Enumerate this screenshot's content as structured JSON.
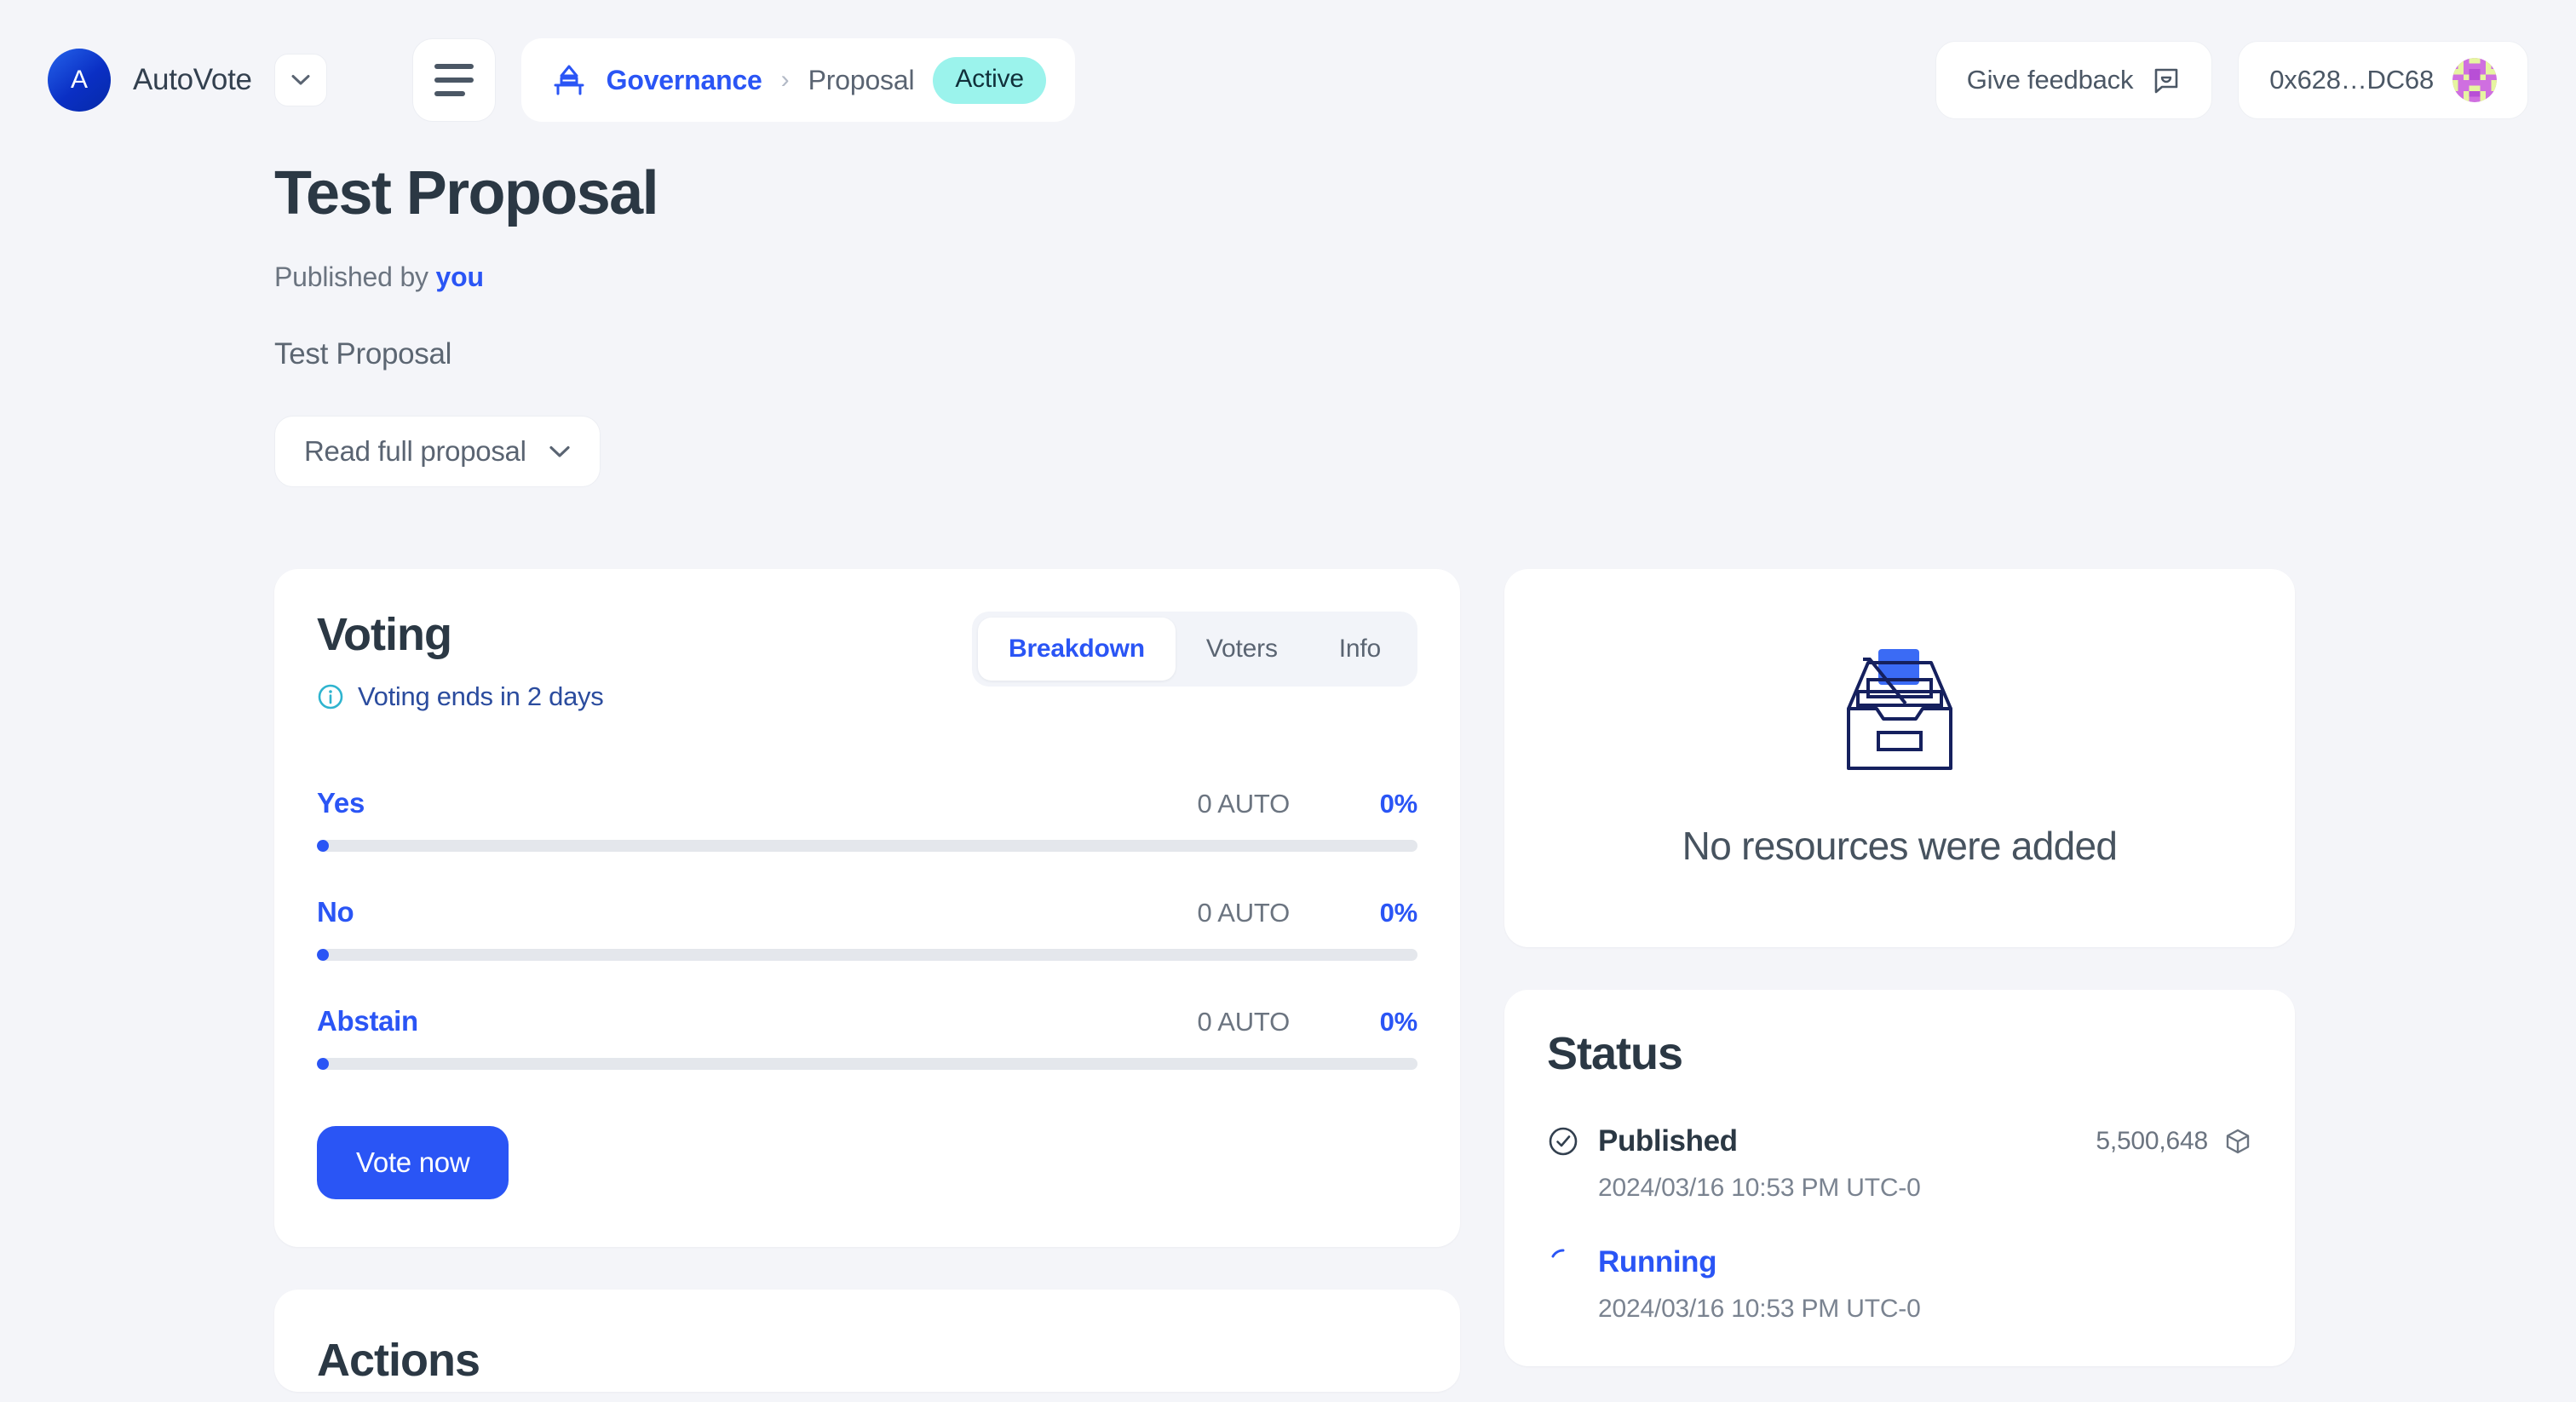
{
  "topbar": {
    "brand_initial": "A",
    "brand_name": "AutoVote",
    "brand_dropdown_icon": "chevron-down-icon",
    "menu_icon": "hamburger-menu-icon",
    "breadcrumb": {
      "icon": "governance-ballot-icon",
      "root": "Governance",
      "separator": "›",
      "current": "Proposal",
      "status": "Active",
      "status_color": "#9bf3ec"
    },
    "feedback_label": "Give feedback",
    "feedback_icon": "speech-bubble-smile-icon",
    "wallet_address": "0x628…DC68",
    "wallet_avatar_icon": "blockies-avatar"
  },
  "proposal": {
    "title": "Test Proposal",
    "published_prefix": "Published by",
    "published_author": "you",
    "summary": "Test Proposal",
    "read_full_label": "Read full proposal",
    "read_full_icon": "chevron-down-icon"
  },
  "voting": {
    "title": "Voting",
    "ends_icon": "info-circle-icon",
    "ends_text": "Voting ends in 2 days",
    "tabs": [
      {
        "label": "Breakdown",
        "active": true
      },
      {
        "label": "Voters",
        "active": false
      },
      {
        "label": "Info",
        "active": false
      }
    ],
    "options": [
      {
        "label": "Yes",
        "amount": "0 AUTO",
        "percent": "0%",
        "fill": 1
      },
      {
        "label": "No",
        "amount": "0 AUTO",
        "percent": "0%",
        "fill": 1
      },
      {
        "label": "Abstain",
        "amount": "0 AUTO",
        "percent": "0%",
        "fill": 1
      }
    ],
    "vote_button": "Vote now",
    "accent_color": "#2a55f5"
  },
  "actions": {
    "title": "Actions"
  },
  "resources": {
    "illustration_icon": "empty-inbox-drawer-icon",
    "empty_text": "No resources were added"
  },
  "status": {
    "title": "Status",
    "items": [
      {
        "icon": "check-circle-icon",
        "name": "Published",
        "block": "5,500,648",
        "block_icon": "cube-icon",
        "time": "2024/03/16 10:53 PM UTC-0",
        "state": "done"
      },
      {
        "icon": "spinner-icon",
        "name": "Running",
        "block": "",
        "block_icon": "",
        "time": "2024/03/16 10:53 PM UTC-0",
        "state": "running"
      }
    ]
  }
}
